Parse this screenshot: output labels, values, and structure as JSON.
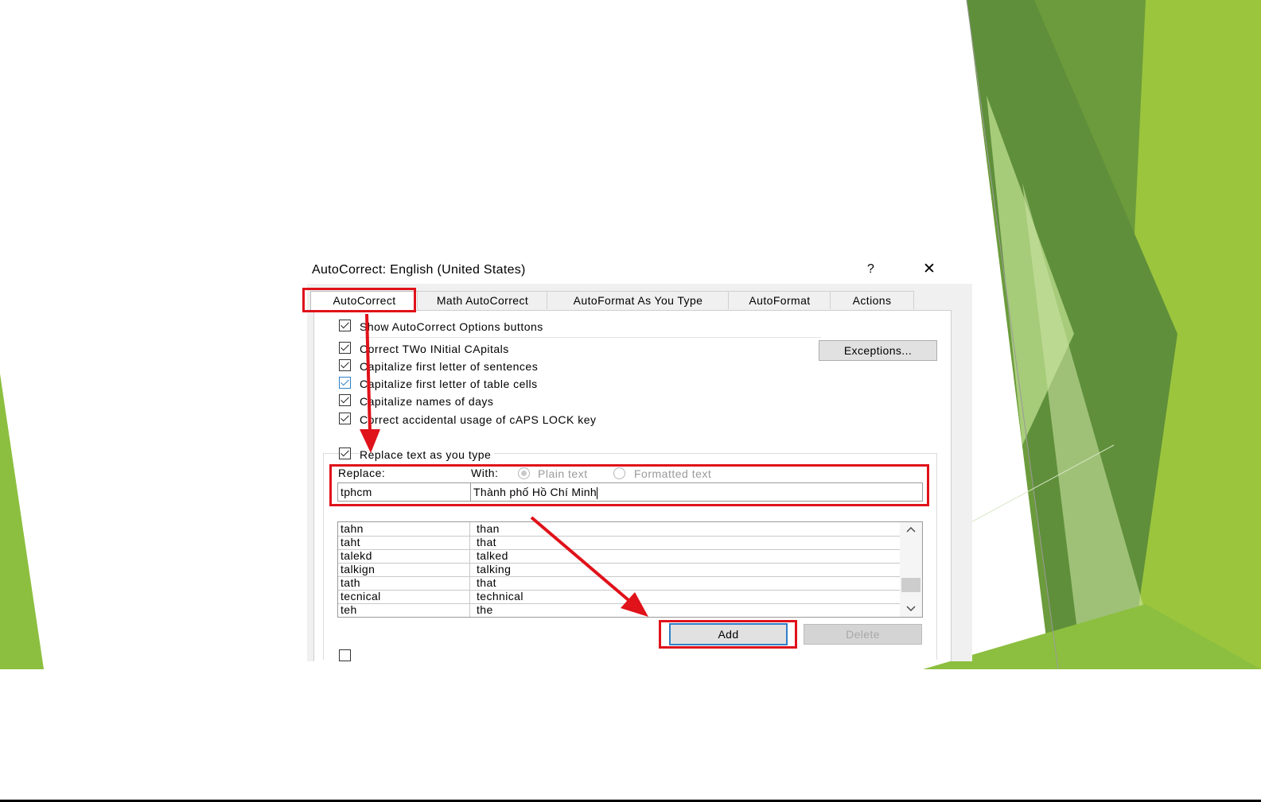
{
  "dialog": {
    "title": "AutoCorrect: English (United States)",
    "help_glyph": "?",
    "close_glyph": "✕"
  },
  "tabs": [
    {
      "label": "AutoCorrect",
      "active": true
    },
    {
      "label": "Math AutoCorrect",
      "active": false
    },
    {
      "label": "AutoFormat As You Type",
      "active": false
    },
    {
      "label": "AutoFormat",
      "active": false
    },
    {
      "label": "Actions",
      "active": false
    }
  ],
  "options": {
    "show_buttons": {
      "label": "Show AutoCorrect Options buttons",
      "checked": true
    },
    "two_initial": {
      "label": "Correct TWo INitial CApitals",
      "checked": true
    },
    "first_sentence": {
      "label": "Capitalize first letter of sentences",
      "checked": true
    },
    "first_table": {
      "label": "Capitalize first letter of table cells",
      "checked": true
    },
    "names_days": {
      "label": "Capitalize names of days",
      "checked": true
    },
    "caps_lock": {
      "label": "Correct accidental usage of cAPS LOCK key",
      "checked": true
    },
    "replace_text": {
      "label": "Replace text as you type",
      "checked": true
    }
  },
  "exceptions_button": "Exceptions...",
  "replace": {
    "replace_label": "Replace:",
    "with_label": "With:",
    "plain_text": "Plain text",
    "formatted_text": "Formatted text",
    "replace_value": "tphcm",
    "with_value": "Thành phố Hồ Chí Minh"
  },
  "entries": [
    {
      "from": "tahn",
      "to": "than"
    },
    {
      "from": "taht",
      "to": "that"
    },
    {
      "from": "talekd",
      "to": "talked"
    },
    {
      "from": "talkign",
      "to": "talking"
    },
    {
      "from": "tath",
      "to": "that"
    },
    {
      "from": "tecnical",
      "to": "technical"
    },
    {
      "from": "teh",
      "to": "the"
    }
  ],
  "buttons": {
    "add": "Add",
    "delete": "Delete"
  },
  "colors": {
    "highlight": "#e0121a",
    "accent": "#2f7fc6",
    "green_dark": "#5f8f3a",
    "green_light": "#9bc53d"
  }
}
